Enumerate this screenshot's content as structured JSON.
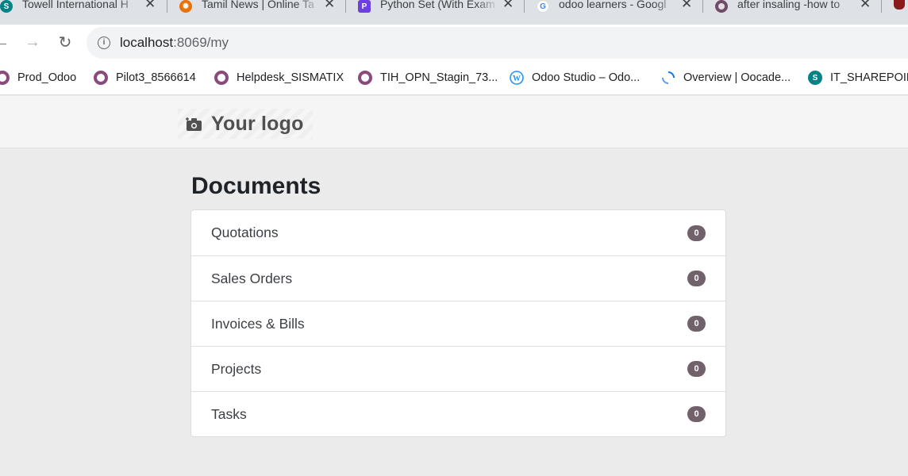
{
  "browser": {
    "tabs": [
      {
        "title": "Towell International H",
        "icon": "sharepoint-icon",
        "color": "#038387"
      },
      {
        "title": "Tamil News | Online Ta",
        "icon": "sun-icon",
        "color": "#e8710a"
      },
      {
        "title": "Python Set (With Exam",
        "icon": "programiz-icon",
        "color": "#6b3fe0"
      },
      {
        "title": "odoo learners - Googl",
        "icon": "google-icon",
        "color": "#4285f4"
      },
      {
        "title": "after insaling -how to",
        "icon": "odoo-ring-icon",
        "color": "#714b67"
      }
    ],
    "url_host": "localhost",
    "url_path": ":8069/my",
    "bookmarks": [
      {
        "label": "Prod_Odoo",
        "icon": "odoo-ring-icon"
      },
      {
        "label": "Pilot3_8566614",
        "icon": "odoo-ring-icon"
      },
      {
        "label": "Helpdesk_SISMATIX",
        "icon": "odoo-ring-icon"
      },
      {
        "label": "TIH_OPN_Stagin_73...",
        "icon": "odoo-ring-icon"
      },
      {
        "label": "Odoo Studio – Odo...",
        "icon": "wordpress-icon"
      },
      {
        "label": "Overview | Oocade...",
        "icon": "refresh-logo-icon"
      },
      {
        "label": "IT_SHAREPOIN",
        "icon": "sharepoint-icon"
      }
    ]
  },
  "site": {
    "logo_text": "Your logo",
    "page_title": "Documents",
    "documents": [
      {
        "label": "Quotations",
        "count": "0"
      },
      {
        "label": "Sales Orders",
        "count": "0"
      },
      {
        "label": "Invoices & Bills",
        "count": "0"
      },
      {
        "label": "Projects",
        "count": "0"
      },
      {
        "label": "Tasks",
        "count": "0"
      }
    ]
  },
  "colors": {
    "badge": "#71616b",
    "odoo_purple": "#8a4a7d",
    "page_bg": "#ebebeb"
  }
}
